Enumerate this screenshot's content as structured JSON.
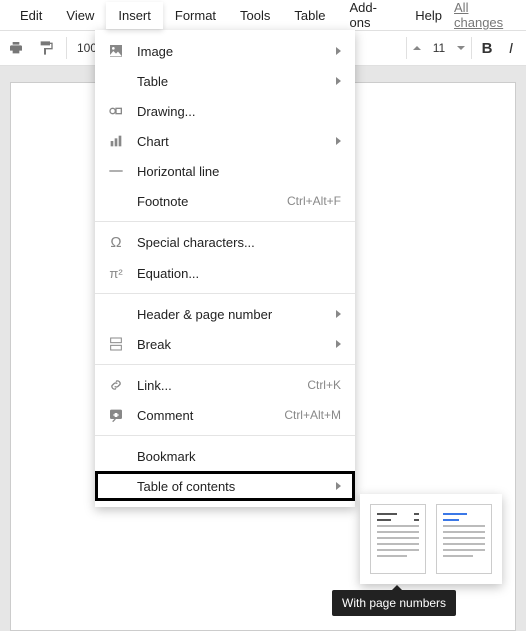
{
  "menubar": {
    "items": [
      "Edit",
      "View",
      "Insert",
      "Format",
      "Tools",
      "Table",
      "Add-ons",
      "Help"
    ],
    "active_index": 2,
    "status": "All changes"
  },
  "toolbar": {
    "zoom": "100%",
    "font_size": "11"
  },
  "insert_menu": {
    "items": [
      {
        "label": "Image",
        "icon": "image-icon",
        "has_submenu": true
      },
      {
        "label": "Table",
        "icon": "",
        "has_submenu": true
      },
      {
        "label": "Drawing...",
        "icon": "drawing-icon"
      },
      {
        "label": "Chart",
        "icon": "chart-icon",
        "has_submenu": true
      },
      {
        "label": "Horizontal line",
        "icon": "hr-icon"
      },
      {
        "label": "Footnote",
        "icon": "",
        "shortcut": "Ctrl+Alt+F"
      }
    ],
    "items2": [
      {
        "label": "Special characters...",
        "icon": "omega-icon"
      },
      {
        "label": "Equation...",
        "icon": "pi-icon"
      }
    ],
    "items3": [
      {
        "label": "Header & page number",
        "icon": "",
        "has_submenu": true
      },
      {
        "label": "Break",
        "icon": "break-icon",
        "has_submenu": true
      }
    ],
    "items4": [
      {
        "label": "Link...",
        "icon": "link-icon",
        "shortcut": "Ctrl+K"
      },
      {
        "label": "Comment",
        "icon": "comment-icon",
        "shortcut": "Ctrl+Alt+M"
      }
    ],
    "items5": [
      {
        "label": "Bookmark",
        "icon": ""
      },
      {
        "label": "Table of contents",
        "icon": "",
        "has_submenu": true,
        "highlighted": true
      }
    ]
  },
  "toc_submenu": {
    "tooltip": "With page numbers"
  }
}
